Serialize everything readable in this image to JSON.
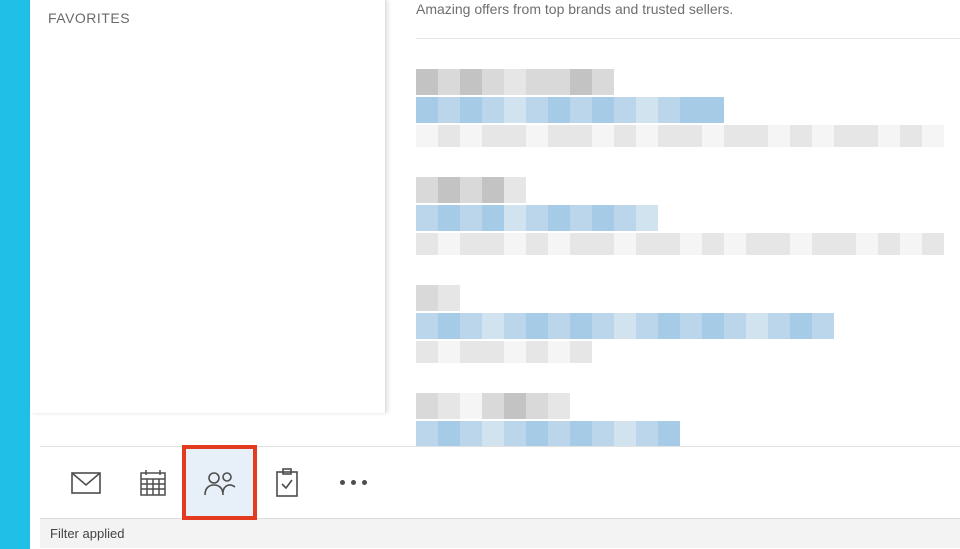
{
  "sidebar": {
    "heading": "FAVORITES"
  },
  "preview": {
    "line1": "Amazing offers from top brands and trusted sellers."
  },
  "nav": {
    "items": [
      {
        "name": "mail"
      },
      {
        "name": "calendar"
      },
      {
        "name": "people",
        "highlighted": true
      },
      {
        "name": "tasks"
      },
      {
        "name": "more"
      }
    ]
  },
  "status": {
    "text": "Filter applied"
  }
}
